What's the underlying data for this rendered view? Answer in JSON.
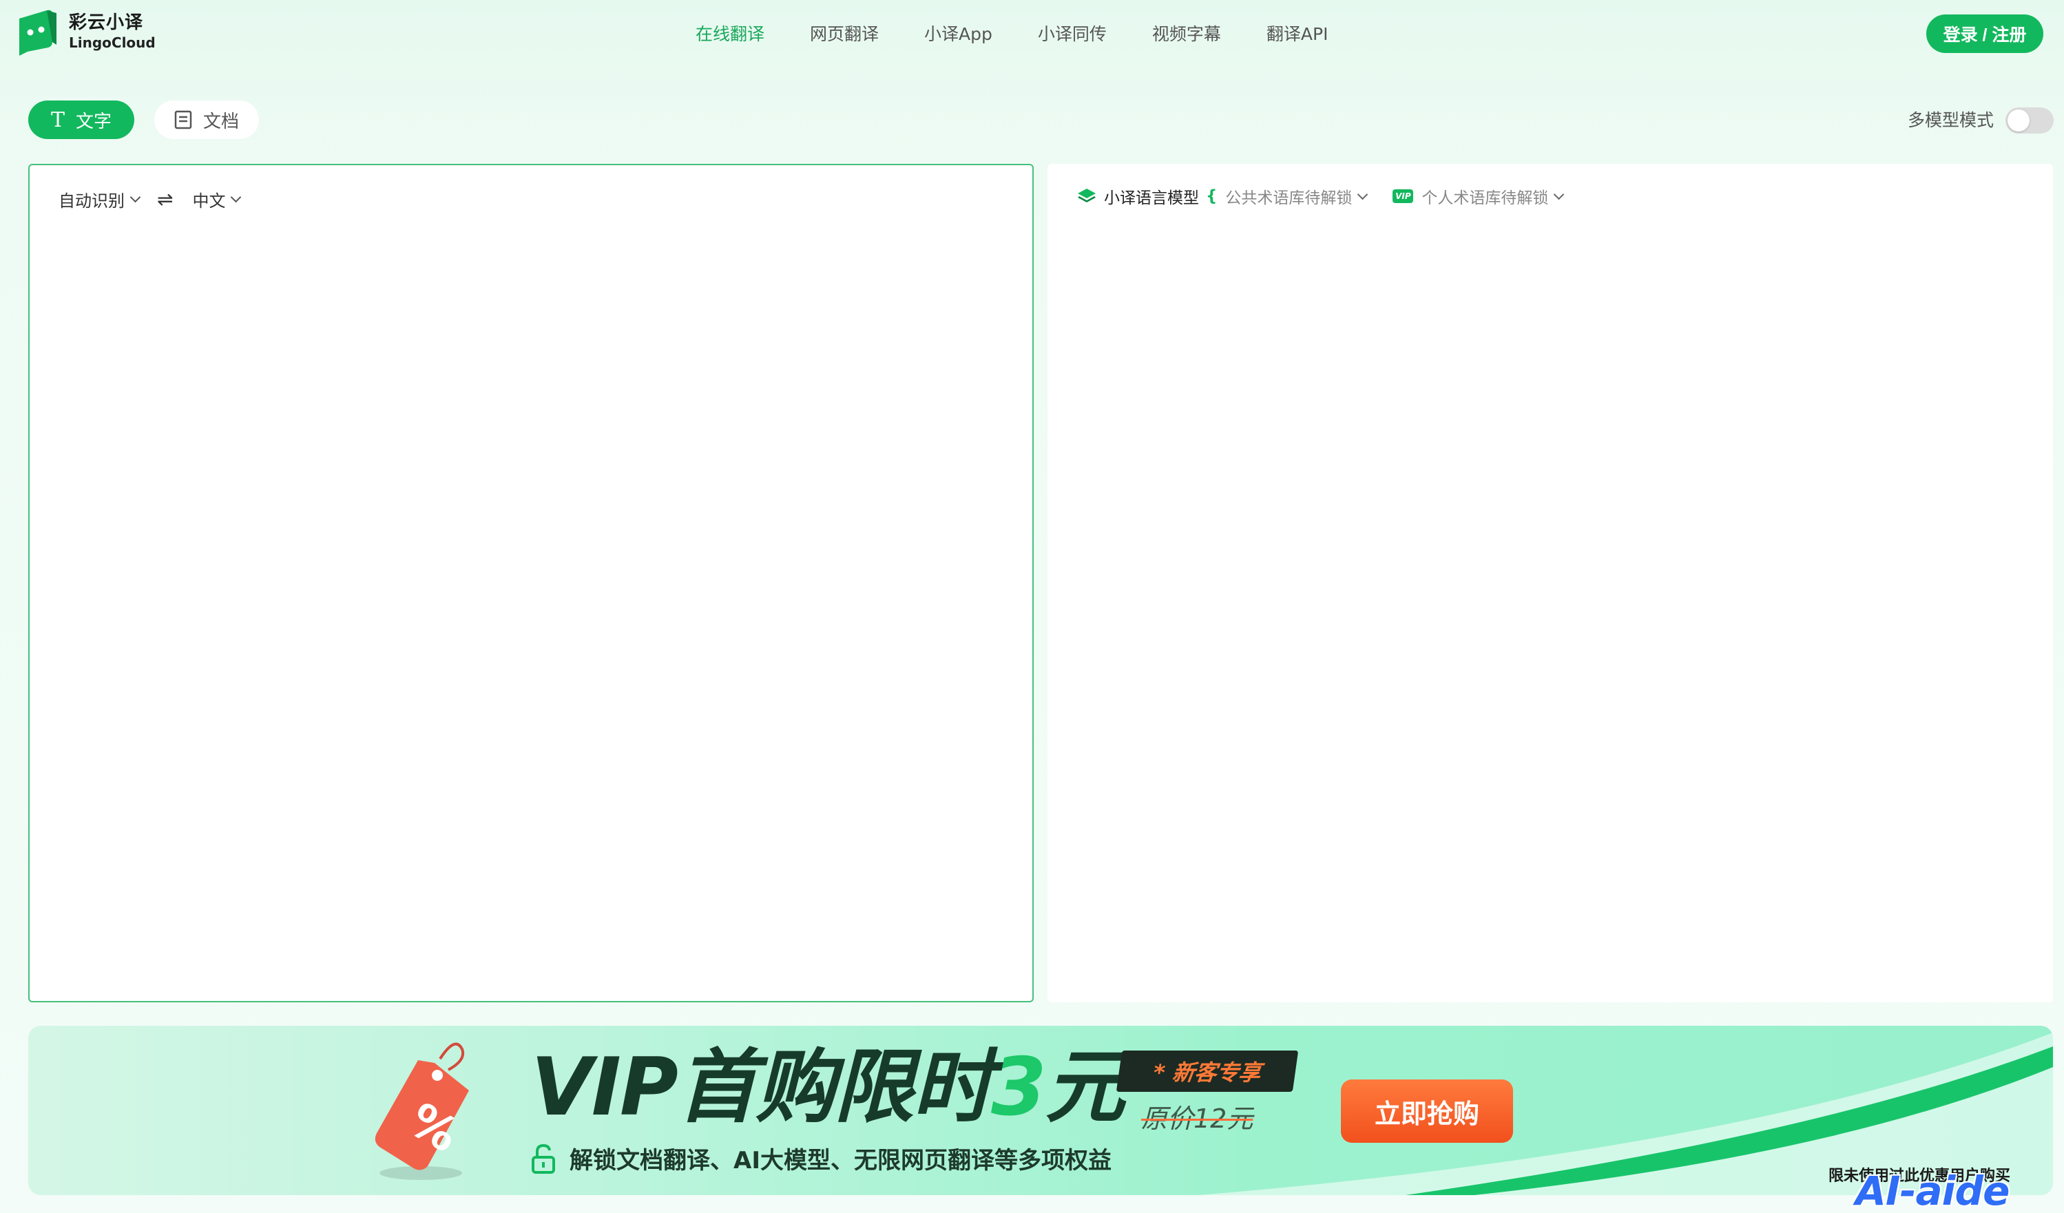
{
  "header": {
    "logo_cn": "彩云小译",
    "logo_en": "LingoCloud",
    "nav": [
      {
        "label": "在线翻译",
        "active": true
      },
      {
        "label": "网页翻译",
        "active": false
      },
      {
        "label": "小译App",
        "active": false
      },
      {
        "label": "小译同传",
        "active": false
      },
      {
        "label": "视频字幕",
        "active": false
      },
      {
        "label": "翻译API",
        "active": false
      }
    ],
    "login_label": "登录 / 注册"
  },
  "modes": {
    "text_icon": "T",
    "text_label": "文字",
    "doc_label": "文档",
    "multi_model_label": "多模型模式",
    "multi_model_on": false
  },
  "source": {
    "from_lang": "自动识别",
    "swap_icon": "⇌",
    "to_lang": "中文",
    "text": ""
  },
  "target": {
    "model_name": "小译语言模型",
    "bracket": "{",
    "public_terms": "公共术语库待解锁",
    "vip_badge": "VIP",
    "personal_terms": "个人术语库待解锁"
  },
  "banner": {
    "title_prefix": "VIP首购限时",
    "title_number": "3",
    "title_suffix": "元",
    "newbie_tag": "* 新客专享",
    "original_price": "原价12元",
    "subtitle": "解锁文档翻译、AI大模型、无限网页翻译等多项权益",
    "buy_label": "立即抢购",
    "limit_note": "限未使用过此优惠用户购买"
  },
  "watermark": "AI-aide",
  "colors": {
    "brand_green": "#12b85d",
    "nav_active": "#1aa75b",
    "buy_orange": "#f2501d"
  }
}
